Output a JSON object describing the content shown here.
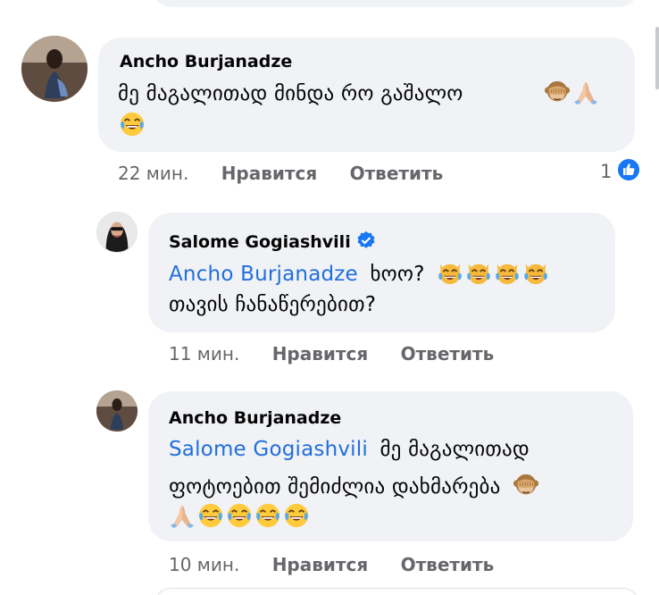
{
  "comments": [
    {
      "author": "Ancho Burjanadze",
      "text_line1": "მე მაგალითად მინდა რო გაშალო",
      "time": "22 мин.",
      "like_label": "Нравится",
      "reply_label": "Ответить",
      "reaction_count": "1"
    },
    {
      "author": "Salome Gogiashvili",
      "mention": "Ancho Burjanadze",
      "text_line1_rest": "ხოო?",
      "text_line2": "თავის ჩანაწერებით?",
      "time": "11 мин.",
      "like_label": "Нравится",
      "reply_label": "Ответить"
    },
    {
      "author": "Ancho Burjanadze",
      "mention": "Salome Gogiashvili",
      "text_line1_rest": "მე მაგალითად",
      "text_line2": "ფოტოებით შემიძლია დახმარება",
      "time": "10 мин.",
      "like_label": "Нравится",
      "reply_label": "Ответить"
    }
  ],
  "icons": {
    "see_no_evil": "see-no-evil-monkey-emoji",
    "folded_hands": "folded-hands-emoji",
    "tears_of_joy": "face-with-tears-of-joy-emoji",
    "cat_tears_of_joy": "cat-with-tears-of-joy-emoji",
    "verified": "verified-badge-icon",
    "like": "thumbs-up-icon"
  },
  "colors": {
    "bubble": "#f0f2f5",
    "mention": "#216fdb",
    "meta": "#65676b",
    "like_badge": "#1877f2"
  }
}
